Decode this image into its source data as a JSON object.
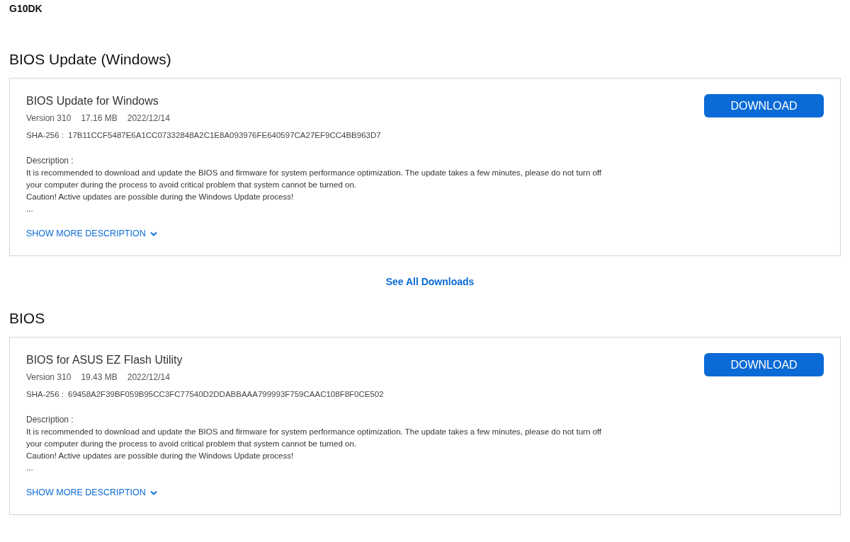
{
  "model": "G10DK",
  "sections": [
    {
      "heading": "BIOS Update (Windows)",
      "file": {
        "title": "BIOS Update for Windows",
        "version": "Version 310",
        "size": "17.16 MB",
        "date": "2022/12/14",
        "sha_label": "SHA-256 :",
        "sha": "17B11CCF5487E6A1CC07332848A2C1E8A093976FE640597CA27EF9CC4BB963D7",
        "description_label": "Description :",
        "description_lines": [
          "It is recommended to download and update the BIOS and firmware for system performance optimization. The update takes a few minutes, please do not turn off",
          "your computer during the process to avoid critical problem that system cannot be turned on.",
          "Caution! Active updates are possible during the Windows Update process!",
          "..."
        ],
        "show_more": "SHOW MORE DESCRIPTION",
        "download": "DOWNLOAD"
      },
      "see_all": "See All Downloads"
    },
    {
      "heading": "BIOS",
      "file": {
        "title": "BIOS for ASUS EZ Flash Utility",
        "version": "Version 310",
        "size": "19.43 MB",
        "date": "2022/12/14",
        "sha_label": "SHA-256 :",
        "sha": "69458A2F39BF059B95CC3FC77540D2DDABBAAA799993F759CAAC108F8F0CE502",
        "description_label": "Description :",
        "description_lines": [
          "It is recommended to download and update the BIOS and firmware for system performance optimization. The update takes a few minutes, please do not turn off",
          "your computer during the process to avoid critical problem that system cannot be turned on.",
          "Caution! Active updates are possible during the Windows Update process!",
          "..."
        ],
        "show_more": "SHOW MORE DESCRIPTION",
        "download": "DOWNLOAD"
      }
    }
  ]
}
